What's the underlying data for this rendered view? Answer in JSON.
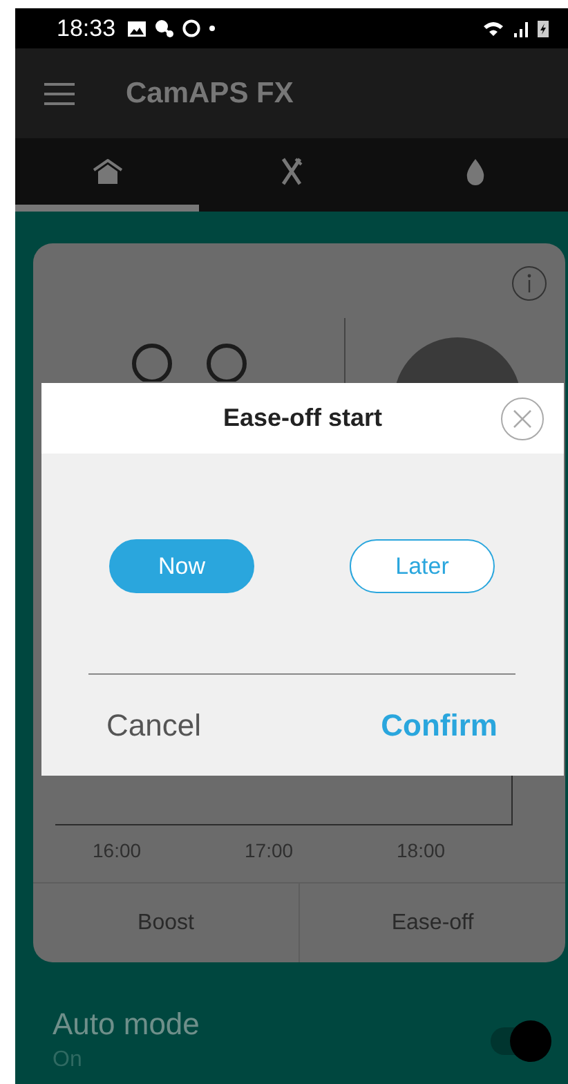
{
  "status_bar": {
    "time": "18:33"
  },
  "app_bar": {
    "title": "CamAPS FX"
  },
  "tabs": [
    {
      "kind": "home",
      "selected": true
    },
    {
      "kind": "meal",
      "selected": false
    },
    {
      "kind": "drop",
      "selected": false
    }
  ],
  "card": {
    "time_labels": [
      "16:00",
      "17:00",
      "18:00"
    ],
    "buttons": [
      "Boost",
      "Ease-off"
    ]
  },
  "dialog": {
    "title": "Ease-off start",
    "options": [
      {
        "label": "Now",
        "selected": true
      },
      {
        "label": "Later",
        "selected": false
      }
    ],
    "buttons": [
      "Cancel",
      "Confirm"
    ]
  },
  "auto_mode": {
    "label": "Auto mode",
    "status": "On",
    "on": true
  }
}
